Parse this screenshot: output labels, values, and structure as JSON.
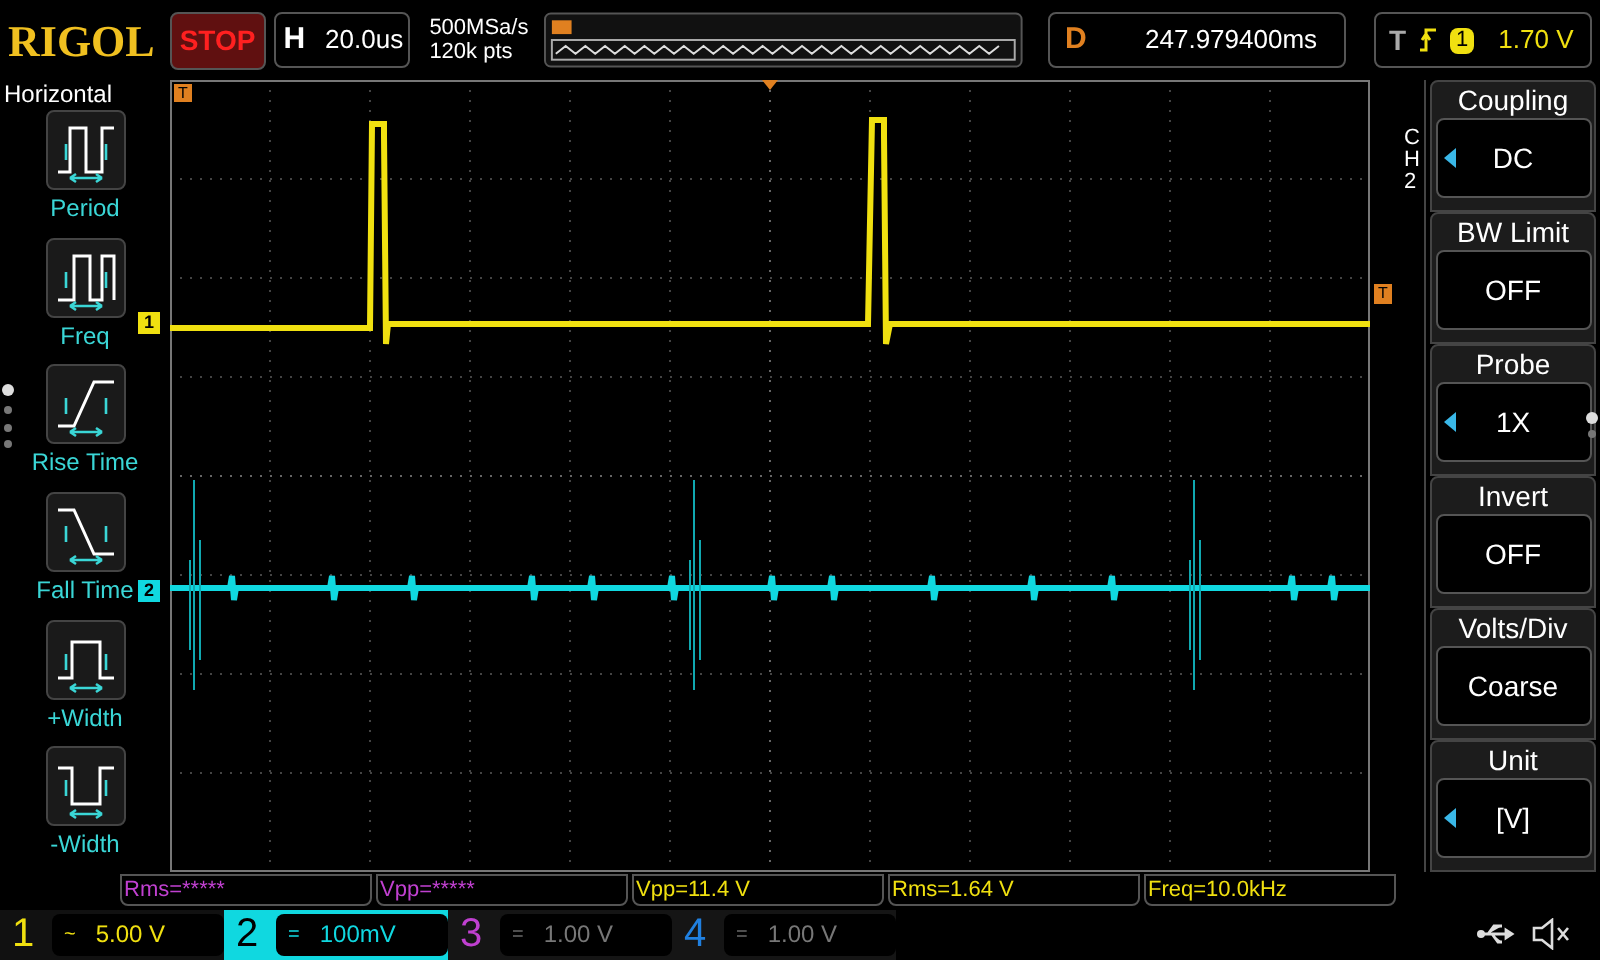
{
  "header": {
    "brand": "RIGOL",
    "run_status": "STOP",
    "horizontal": {
      "label": "H",
      "timebase": "20.0us"
    },
    "sample_rate": "500MSa/s",
    "memory_depth": "120k pts",
    "delay": {
      "label": "D",
      "value": "247.979400ms"
    },
    "trigger": {
      "label": "T",
      "source": "1",
      "level": "1.70 V"
    }
  },
  "left_menu": {
    "title": "Horizontal",
    "items": [
      {
        "label": "Period",
        "kind": "period"
      },
      {
        "label": "Freq",
        "kind": "freq"
      },
      {
        "label": "Rise Time",
        "kind": "rise"
      },
      {
        "label": "Fall Time",
        "kind": "fall"
      },
      {
        "label": "+Width",
        "kind": "pwidth"
      },
      {
        "label": "-Width",
        "kind": "nwidth"
      }
    ]
  },
  "scope": {
    "top_trigger_marker": "T",
    "trigger_level_marker": "T",
    "channel_markers": [
      {
        "label": "1",
        "color": "#f0e010"
      },
      {
        "label": "2",
        "color": "#10d8e0"
      }
    ]
  },
  "right_menu": {
    "channel": "CH2",
    "items": [
      {
        "title": "Coupling",
        "value": "DC",
        "adjustable": true
      },
      {
        "title": "BW Limit",
        "value": "OFF",
        "adjustable": false
      },
      {
        "title": "Probe",
        "value": "1X",
        "adjustable": true
      },
      {
        "title": "Invert",
        "value": "OFF",
        "adjustable": false
      },
      {
        "title": "Volts/Div",
        "value": "Coarse",
        "adjustable": false
      },
      {
        "title": "Unit",
        "value": "[V]",
        "adjustable": true
      }
    ]
  },
  "measurements": [
    {
      "text": "Rms=*****",
      "color": "#c040d0"
    },
    {
      "text": "Vpp=*****",
      "color": "#c040d0"
    },
    {
      "text": "Vpp=11.4 V",
      "color": "#f0e010"
    },
    {
      "text": "Rms=1.64 V",
      "color": "#f0e010"
    },
    {
      "text": "Freq=10.0kHz",
      "color": "#f0e010"
    }
  ],
  "channels": [
    {
      "number": "1",
      "coupling": "~",
      "scale": "5.00 V",
      "selected": false,
      "enabled": true,
      "color": "#f0e010"
    },
    {
      "number": "2",
      "coupling": "=",
      "scale": "100mV",
      "selected": true,
      "enabled": true,
      "color": "#10d8e0"
    },
    {
      "number": "3",
      "coupling": "=",
      "scale": "1.00 V",
      "selected": false,
      "enabled": false,
      "color": "#c040d0"
    },
    {
      "number": "4",
      "coupling": "=",
      "scale": "1.00 V",
      "selected": false,
      "enabled": false,
      "color": "#2080e0"
    }
  ]
}
